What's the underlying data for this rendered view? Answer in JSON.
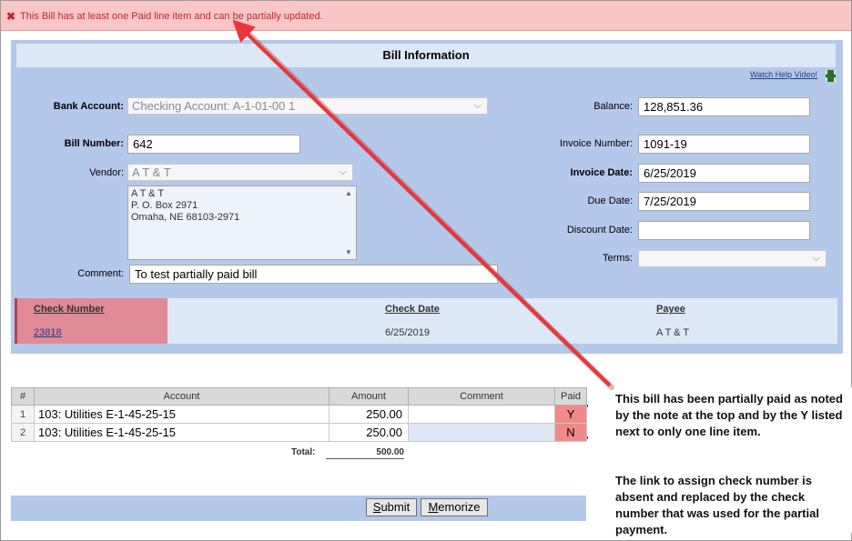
{
  "alert": {
    "icon": "close-icon",
    "message": "This Bill has at least one Paid line item and can be partially updated."
  },
  "panel": {
    "title": "Bill Information",
    "help_link": "Watch Help Video!",
    "bank_account": {
      "label": "Bank Account:",
      "value": "Checking Account: A-1-01-00 1"
    },
    "bill_number": {
      "label": "Bill Number:",
      "value": "642"
    },
    "vendor": {
      "label": "Vendor:",
      "value": "A T & T",
      "address": [
        "A T & T",
        "P. O. Box 2971",
        "Omaha, NE 68103-2971"
      ]
    },
    "comment": {
      "label": "Comment:",
      "value": "To test partially paid bill"
    },
    "balance": {
      "label": "Balance:",
      "value": "128,851.36"
    },
    "invoice_number": {
      "label": "Invoice Number:",
      "value": "1091-19"
    },
    "invoice_date": {
      "label": "Invoice Date:",
      "value": "6/25/2019"
    },
    "due_date": {
      "label": "Due Date:",
      "value": "7/25/2019"
    },
    "discount_date": {
      "label": "Discount Date:",
      "value": ""
    },
    "terms": {
      "label": "Terms:",
      "value": ""
    }
  },
  "checks": {
    "headers": [
      "Check Number",
      "Check Date",
      "Payee"
    ],
    "row": {
      "number": "23818",
      "date": "6/25/2019",
      "payee": "A T & T"
    }
  },
  "grid": {
    "headers": [
      "#",
      "Account",
      "Amount",
      "Comment",
      "Paid"
    ],
    "rows": [
      {
        "num": "1",
        "account": "103: Utilities E-1-45-25-15",
        "amount": "250.00",
        "comment": "",
        "paid": "Y"
      },
      {
        "num": "2",
        "account": "103: Utilities E-1-45-25-15",
        "amount": "250.00",
        "comment": "",
        "paid": "N"
      }
    ],
    "total_label": "Total:",
    "total_value": "500.00"
  },
  "buttons": {
    "submit": "Submit",
    "memorize": "Memorize"
  },
  "annotation": {
    "para1": "This bill has been partially paid as noted by the note at the top and by the Y listed next to only one line item.",
    "para2": "The link to assign check number is absent and replaced by the check number that was used for the partial payment."
  },
  "colors": {
    "alert_bg": "#f9c6c6",
    "alert_text": "#c0262d",
    "panel_bg": "#b4c8ea",
    "paid_bg": "#f08a8a",
    "arrow": "#e8363a"
  }
}
